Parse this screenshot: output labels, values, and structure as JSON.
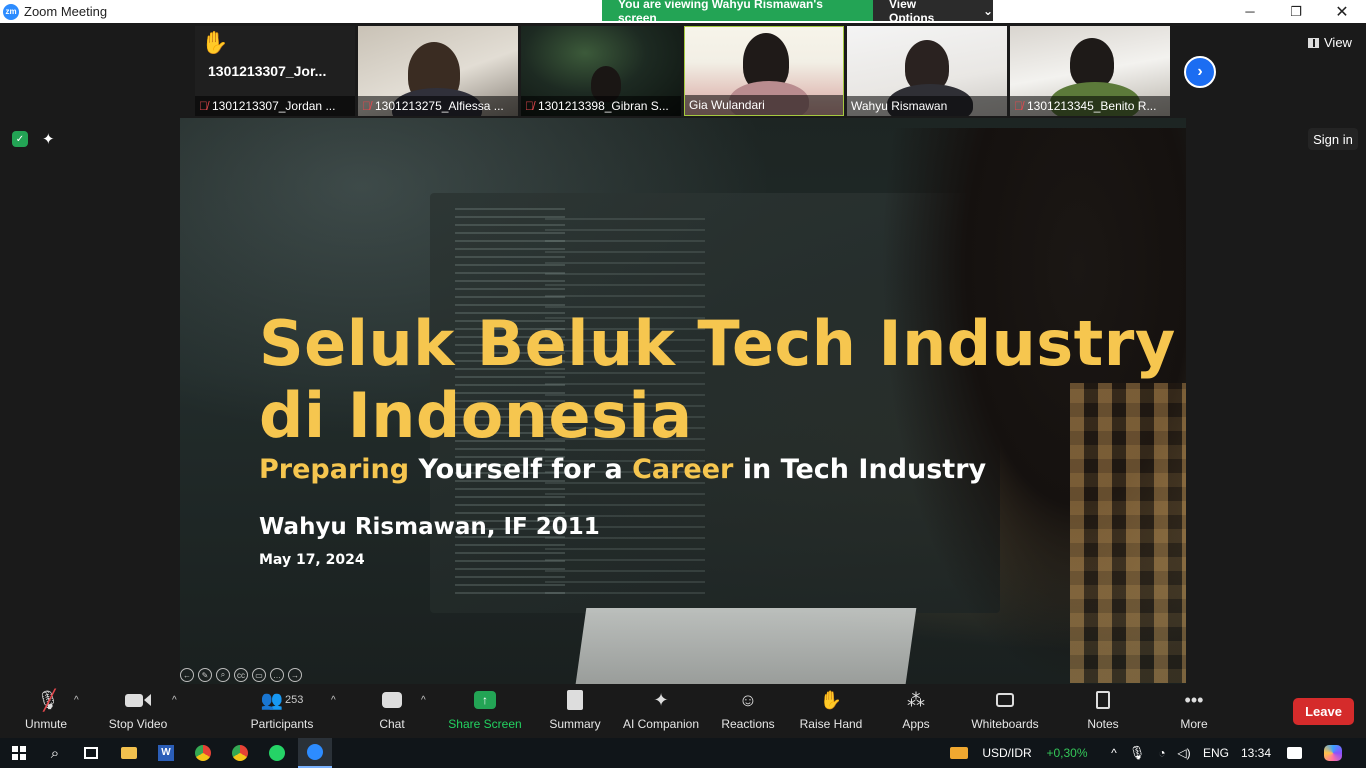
{
  "window": {
    "title": "Zoom Meeting",
    "logo_text": "zm",
    "min": "─",
    "max": "❐",
    "close": "✕"
  },
  "banner": {
    "text": "You are viewing Wahyu Rismawan's screen",
    "options_label": "View Options",
    "options_caret": "⌄"
  },
  "gallery": {
    "tiles": [
      {
        "name": "1301213307_Jordan ...",
        "big_label": "1301213307_Jor...",
        "muted": true,
        "hand_raised": true
      },
      {
        "name": "1301213275_Alfiessa ...",
        "muted": true
      },
      {
        "name": "1301213398_Gibran S...",
        "muted": true
      },
      {
        "name": "Gia Wulandari",
        "muted": false
      },
      {
        "name": "Wahyu Rismawan",
        "muted": false
      },
      {
        "name": "1301213345_Benito R...",
        "muted": true
      }
    ],
    "next_icon": "›",
    "view_label": "View"
  },
  "top_left": {
    "shield_icon": "✓",
    "sparkle_icon": "✦"
  },
  "signin_label": "Sign in",
  "slide": {
    "title_line1": "Seluk Beluk Tech Industry",
    "title_line2": "di Indonesia",
    "subtitle_parts": [
      "Preparing",
      " Yourself for a ",
      "Career",
      " in Tech Industry"
    ],
    "author": "Wahyu Rismawan, IF 2011",
    "date": "May 17, 2024"
  },
  "annotation_tools": [
    "←",
    "✎",
    "⌕",
    "cc",
    "▭",
    "…",
    "→"
  ],
  "toolbar": {
    "unmute": "Unmute",
    "stop_video": "Stop Video",
    "participants": "Participants",
    "participants_count": "253",
    "chat": "Chat",
    "share_screen": "Share Screen",
    "summary": "Summary",
    "ai_companion": "AI Companion",
    "reactions": "Reactions",
    "raise_hand": "Raise Hand",
    "apps": "Apps",
    "whiteboards": "Whiteboards",
    "notes": "Notes",
    "more": "More",
    "leave": "Leave",
    "caret": "^"
  },
  "taskbar": {
    "currency_pair": "USD/IDR",
    "currency_change": "+0,30%",
    "language": "ENG",
    "time": "13:34"
  }
}
